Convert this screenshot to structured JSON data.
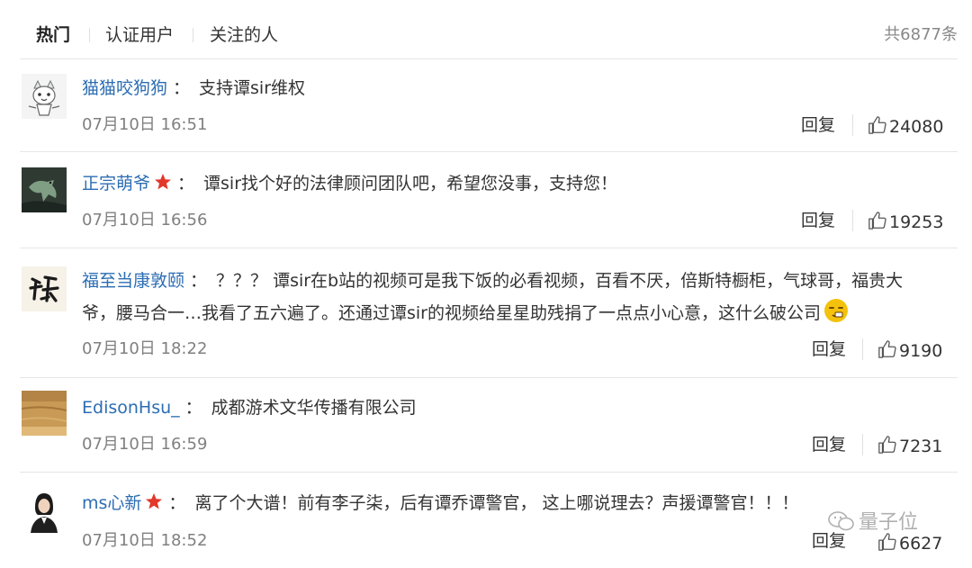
{
  "tabs": [
    {
      "label": "热门",
      "active": true
    },
    {
      "label": "认证用户",
      "active": false
    },
    {
      "label": "关注的人",
      "active": false
    }
  ],
  "total_count": "共6877条",
  "comments": [
    {
      "username": "猫猫咬狗狗",
      "colon": "：",
      "text": "支持谭sir维权",
      "time": "07月10日 16:51",
      "reply": "回复",
      "likes": "24080",
      "vip": false
    },
    {
      "username": "正宗萌爷",
      "colon": "：",
      "text": "谭sir找个好的法律顾问团队吧，希望您没事，支持您！",
      "time": "07月10日 16:56",
      "reply": "回复",
      "likes": "19253",
      "vip": true
    },
    {
      "username": "福至当康敦颐",
      "colon": "：",
      "text": "？？？ 谭sir在b站的视频可是我下饭的必看视频，百看不厌，倍斯特橱柜，气球哥，福贵大",
      "text_line2": "爷，腰马合一…我看了五六遍了。还通过谭sir的视频给星星助残捐了一点点小心意，这什么破公司",
      "time": "07月10日 18:22",
      "reply": "回复",
      "likes": "9190",
      "vip": false
    },
    {
      "username": "EdisonHsu_",
      "colon": "：",
      "text": "成都游术文华传播有限公司",
      "time": "07月10日 16:59",
      "reply": "回复",
      "likes": "7231",
      "vip": false
    },
    {
      "username": "ms心新",
      "colon": "：",
      "text": "离了个大谱！前有李子柒，后有谭乔谭警官， 这上哪说理去？声援谭警官！！！",
      "time": "07月10日 18:52",
      "reply": "回复",
      "likes": "6627",
      "vip": true
    }
  ],
  "watermark": "量子位",
  "colors": {
    "username": "#2b6db3",
    "time": "#808080",
    "vip_star": "#e2382b",
    "emoji": "#f4c20d"
  }
}
